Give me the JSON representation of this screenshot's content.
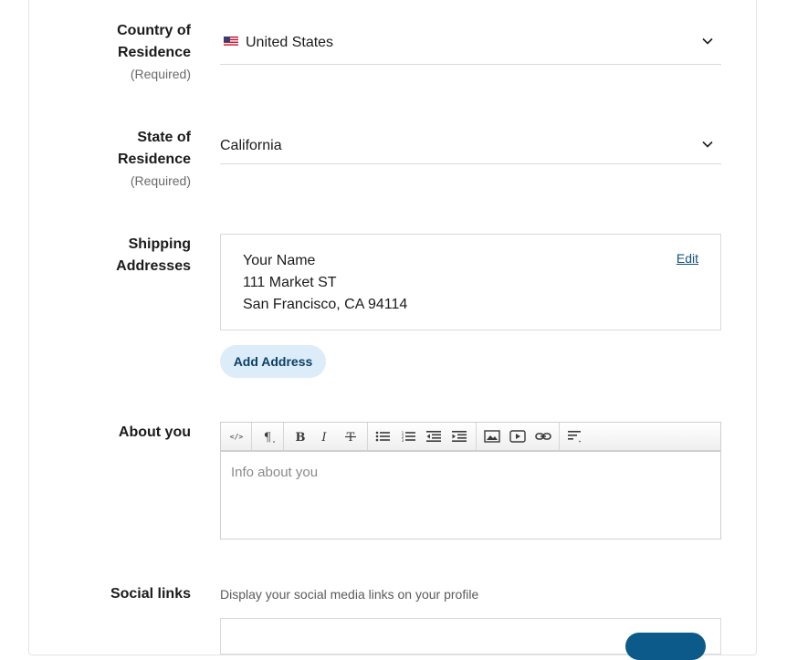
{
  "country": {
    "label_line1": "Country of",
    "label_line2": "Residence",
    "required": "(Required)",
    "value": "United States"
  },
  "state": {
    "label_line1": "State of",
    "label_line2": "Residence",
    "required": "(Required)",
    "value": "California"
  },
  "shipping": {
    "label_line1": "Shipping",
    "label_line2": "Addresses",
    "address": {
      "name": "Your Name",
      "street": "111 Market ST",
      "city_line": "San Francisco, CA 94114"
    },
    "edit_label": "Edit",
    "add_label": "Add Address"
  },
  "about": {
    "label": "About you",
    "placeholder": "Info about you"
  },
  "toolbar": {
    "buttons": [
      "code-view",
      "paragraph",
      "bold",
      "italic",
      "strikethrough",
      "bullet-list",
      "numbered-list",
      "outdent",
      "indent",
      "image",
      "video",
      "link",
      "align"
    ]
  },
  "social": {
    "label": "Social links",
    "description": "Display your social media links on your profile"
  },
  "colors": {
    "accent": "#14507a",
    "button_bg": "#dcecf9",
    "button_text": "#0b3f66"
  }
}
